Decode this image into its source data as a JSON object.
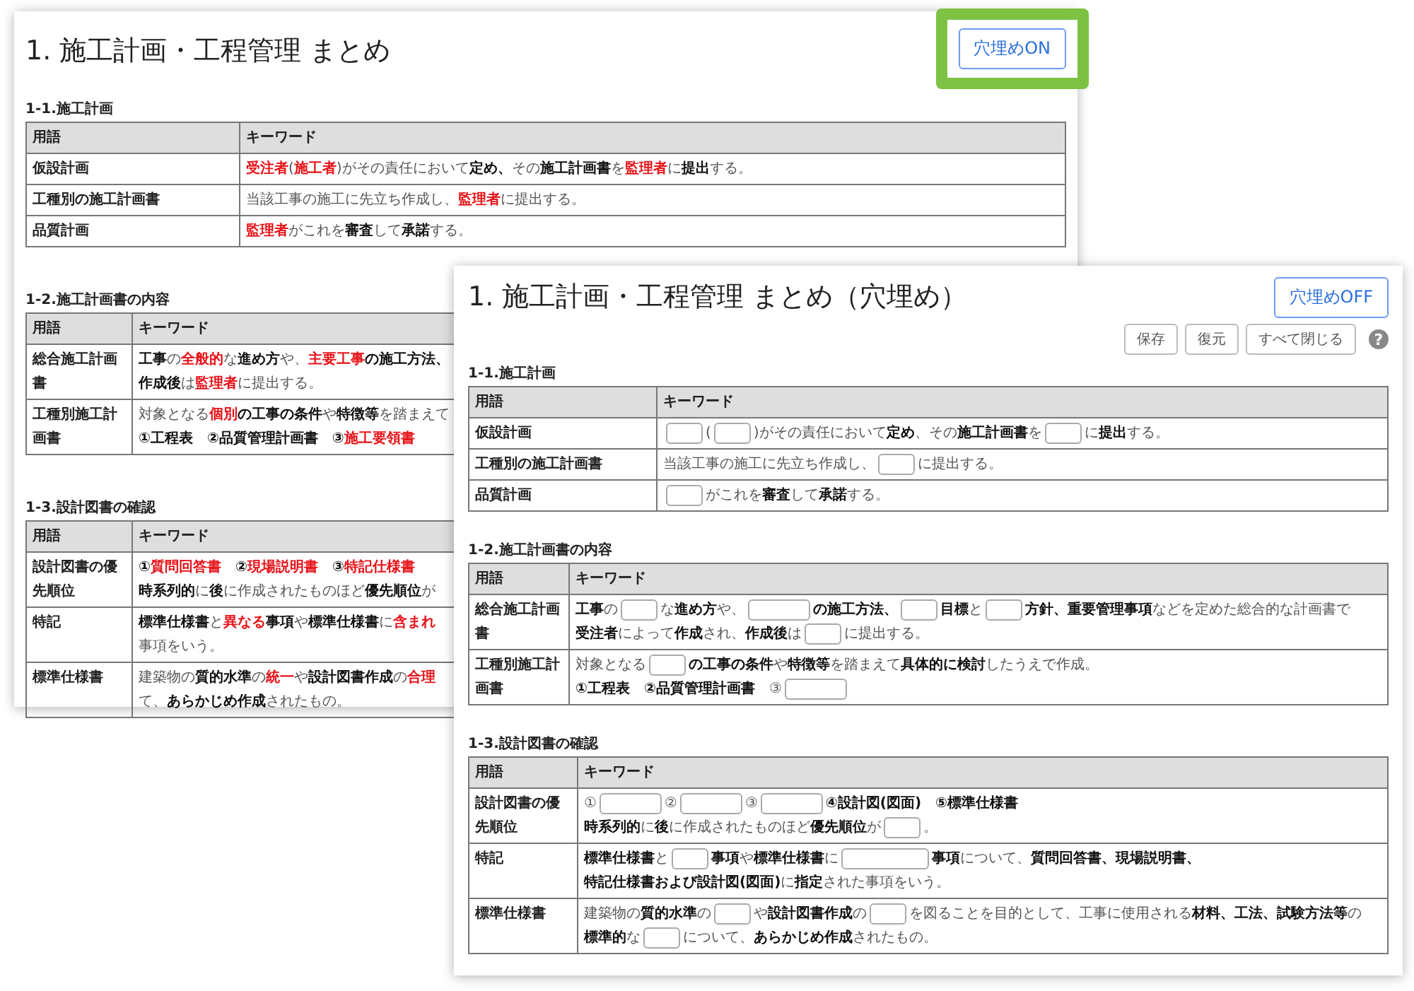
{
  "back_window": {
    "title": "1. 施工計画・工程管理 まとめ",
    "toggle_button": "穴埋めON",
    "sections": [
      {
        "heading": "1-1.施工計画",
        "columns": [
          "用語",
          "キーワード"
        ],
        "rows": [
          {
            "term": "仮設計画",
            "keyword": [
              {
                "kind": "red",
                "text": "受注者"
              },
              {
                "kind": "text",
                "text": "("
              },
              {
                "kind": "red",
                "text": "施工者"
              },
              {
                "kind": "text",
                "text": ")がその責任において"
              },
              {
                "kind": "bold",
                "text": "定め、"
              },
              {
                "kind": "text",
                "text": "その"
              },
              {
                "kind": "bold",
                "text": "施工計画書"
              },
              {
                "kind": "text",
                "text": "を"
              },
              {
                "kind": "red",
                "text": "監理者"
              },
              {
                "kind": "text",
                "text": "に"
              },
              {
                "kind": "bold",
                "text": "提出"
              },
              {
                "kind": "text",
                "text": "する。"
              }
            ]
          },
          {
            "term": "工種別の施工計画書",
            "keyword": [
              {
                "kind": "text",
                "text": "当該工事の施工に先立ち作成し、"
              },
              {
                "kind": "red",
                "text": "監理者"
              },
              {
                "kind": "text",
                "text": "に提出する。"
              }
            ]
          },
          {
            "term": "品質計画",
            "keyword": [
              {
                "kind": "red",
                "text": "監理者"
              },
              {
                "kind": "text",
                "text": "がこれを"
              },
              {
                "kind": "bold",
                "text": "審査"
              },
              {
                "kind": "text",
                "text": "して"
              },
              {
                "kind": "bold",
                "text": "承諾"
              },
              {
                "kind": "text",
                "text": "する。"
              }
            ]
          }
        ]
      },
      {
        "heading": "1-2.施工計画書の内容",
        "columns": [
          "用語",
          "キーワード"
        ],
        "rows": [
          {
            "term": "総合施工計画書",
            "keyword": [
              {
                "kind": "bold",
                "text": "工事"
              },
              {
                "kind": "text",
                "text": "の"
              },
              {
                "kind": "red",
                "text": "全般的"
              },
              {
                "kind": "text",
                "text": "な"
              },
              {
                "kind": "bold",
                "text": "進め方"
              },
              {
                "kind": "text",
                "text": "や、"
              },
              {
                "kind": "red",
                "text": "主要工事"
              },
              {
                "kind": "bold",
                "text": "の施工方法、"
              },
              {
                "kind": "break"
              },
              {
                "kind": "bold",
                "text": "作成後"
              },
              {
                "kind": "text",
                "text": "は"
              },
              {
                "kind": "red",
                "text": "監理者"
              },
              {
                "kind": "text",
                "text": "に提出する。"
              }
            ]
          },
          {
            "term": "工種別施工計画書",
            "keyword": [
              {
                "kind": "text",
                "text": "対象となる"
              },
              {
                "kind": "red",
                "text": "個別"
              },
              {
                "kind": "bold",
                "text": "の工事の条件"
              },
              {
                "kind": "text",
                "text": "や"
              },
              {
                "kind": "bold",
                "text": "特徴等"
              },
              {
                "kind": "text",
                "text": "を踏まえて"
              },
              {
                "kind": "break"
              },
              {
                "kind": "bold",
                "text": "①工程表　②品質管理計画書　③"
              },
              {
                "kind": "red",
                "text": "施工要領書"
              }
            ]
          }
        ]
      },
      {
        "heading": "1-3.設計図書の確認",
        "columns": [
          "用語",
          "キーワード"
        ],
        "rows": [
          {
            "term": "設計図書の優先順位",
            "keyword": [
              {
                "kind": "bold",
                "text": "①"
              },
              {
                "kind": "red",
                "text": "質問回答書"
              },
              {
                "kind": "bold",
                "text": "　②"
              },
              {
                "kind": "red",
                "text": "現場説明書"
              },
              {
                "kind": "bold",
                "text": "　③"
              },
              {
                "kind": "red",
                "text": "特記仕様書"
              },
              {
                "kind": "break"
              },
              {
                "kind": "bold",
                "text": "時系列的"
              },
              {
                "kind": "text",
                "text": "に"
              },
              {
                "kind": "bold",
                "text": "後"
              },
              {
                "kind": "text",
                "text": "に作成されたものほど"
              },
              {
                "kind": "bold",
                "text": "優先順位"
              },
              {
                "kind": "text",
                "text": "が"
              }
            ]
          },
          {
            "term": "特記",
            "keyword": [
              {
                "kind": "bold",
                "text": "標準仕様書"
              },
              {
                "kind": "text",
                "text": "と"
              },
              {
                "kind": "red",
                "text": "異なる"
              },
              {
                "kind": "bold",
                "text": "事項"
              },
              {
                "kind": "text",
                "text": "や"
              },
              {
                "kind": "bold",
                "text": "標準仕様書"
              },
              {
                "kind": "text",
                "text": "に"
              },
              {
                "kind": "red",
                "text": "含まれ"
              },
              {
                "kind": "break"
              },
              {
                "kind": "text",
                "text": "事項をいう。"
              }
            ]
          },
          {
            "term": "標準仕様書",
            "keyword": [
              {
                "kind": "text",
                "text": "建築物の"
              },
              {
                "kind": "bold",
                "text": "質的水準"
              },
              {
                "kind": "text",
                "text": "の"
              },
              {
                "kind": "red",
                "text": "統一"
              },
              {
                "kind": "text",
                "text": "や"
              },
              {
                "kind": "bold",
                "text": "設計図書作成"
              },
              {
                "kind": "text",
                "text": "の"
              },
              {
                "kind": "red",
                "text": "合理"
              },
              {
                "kind": "break"
              },
              {
                "kind": "text",
                "text": "て、"
              },
              {
                "kind": "bold",
                "text": "あらかじめ作成"
              },
              {
                "kind": "text",
                "text": "されたもの。"
              }
            ]
          }
        ]
      }
    ]
  },
  "front_window": {
    "title": "1. 施工計画・工程管理 まとめ（穴埋め）",
    "toggle_button": "穴埋めOFF",
    "toolbar": [
      "保存",
      "復元",
      "すべて閉じる"
    ],
    "help": "?",
    "sections": [
      {
        "heading": "1-1.施工計画",
        "columns": [
          "用語",
          "キーワード"
        ],
        "rows": [
          {
            "term": "仮設計画",
            "keyword": [
              {
                "kind": "blank"
              },
              {
                "kind": "text",
                "text": "("
              },
              {
                "kind": "blank"
              },
              {
                "kind": "text",
                "text": ")がその責任において"
              },
              {
                "kind": "bold",
                "text": "定め"
              },
              {
                "kind": "text",
                "text": "、その"
              },
              {
                "kind": "bold",
                "text": "施工計画書"
              },
              {
                "kind": "text",
                "text": "を"
              },
              {
                "kind": "blank"
              },
              {
                "kind": "text",
                "text": "に"
              },
              {
                "kind": "bold",
                "text": "提出"
              },
              {
                "kind": "text",
                "text": "する。"
              }
            ]
          },
          {
            "term": "工種別の施工計画書",
            "keyword": [
              {
                "kind": "text",
                "text": "当該工事の施工に先立ち作成し、"
              },
              {
                "kind": "blank"
              },
              {
                "kind": "text",
                "text": "に提出する。"
              }
            ]
          },
          {
            "term": "品質計画",
            "keyword": [
              {
                "kind": "blank"
              },
              {
                "kind": "text",
                "text": "がこれを"
              },
              {
                "kind": "bold",
                "text": "審査"
              },
              {
                "kind": "text",
                "text": "して"
              },
              {
                "kind": "bold",
                "text": "承諾"
              },
              {
                "kind": "text",
                "text": "する。"
              }
            ]
          }
        ]
      },
      {
        "heading": "1-2.施工計画書の内容",
        "columns": [
          "用語",
          "キーワード"
        ],
        "rows": [
          {
            "term": "総合施工計画書",
            "keyword": [
              {
                "kind": "bold",
                "text": "工事"
              },
              {
                "kind": "text",
                "text": "の"
              },
              {
                "kind": "blank"
              },
              {
                "kind": "text",
                "text": "な"
              },
              {
                "kind": "bold",
                "text": "進め方"
              },
              {
                "kind": "text",
                "text": "や、"
              },
              {
                "kind": "wide_blank"
              },
              {
                "kind": "bold",
                "text": "の施工方法、"
              },
              {
                "kind": "blank"
              },
              {
                "kind": "bold",
                "text": "目標"
              },
              {
                "kind": "text",
                "text": "と"
              },
              {
                "kind": "blank"
              },
              {
                "kind": "bold",
                "text": "方針、重要管理事項"
              },
              {
                "kind": "text",
                "text": "などを定めた総合的な計画書で"
              },
              {
                "kind": "bold",
                "text": "受注者"
              },
              {
                "kind": "text",
                "text": "によって"
              },
              {
                "kind": "bold",
                "text": "作成"
              },
              {
                "kind": "text",
                "text": "され、"
              },
              {
                "kind": "bold",
                "text": "作成後"
              },
              {
                "kind": "text",
                "text": "は"
              },
              {
                "kind": "blank"
              },
              {
                "kind": "text",
                "text": "に提出する。"
              }
            ]
          },
          {
            "term": "工種別施工計画書",
            "keyword": [
              {
                "kind": "text",
                "text": "対象となる"
              },
              {
                "kind": "blank"
              },
              {
                "kind": "bold",
                "text": "の工事の条件"
              },
              {
                "kind": "text",
                "text": "や"
              },
              {
                "kind": "bold",
                "text": "特徴等"
              },
              {
                "kind": "text",
                "text": "を踏まえて"
              },
              {
                "kind": "bold",
                "text": "具体的に検討"
              },
              {
                "kind": "text",
                "text": "したうえで作成。"
              },
              {
                "kind": "break"
              },
              {
                "kind": "bold",
                "text": "①工程表　②品質管理計画書　"
              },
              {
                "kind": "text",
                "text": "③"
              },
              {
                "kind": "wide_blank"
              }
            ]
          }
        ]
      },
      {
        "heading": "1-3.設計図書の確認",
        "columns": [
          "用語",
          "キーワード"
        ],
        "rows": [
          {
            "term": "設計図書の優先順位",
            "keyword": [
              {
                "kind": "text",
                "text": "①"
              },
              {
                "kind": "wide_blank"
              },
              {
                "kind": "text",
                "text": "②"
              },
              {
                "kind": "wide_blank"
              },
              {
                "kind": "text",
                "text": "③"
              },
              {
                "kind": "wide_blank"
              },
              {
                "kind": "bold",
                "text": "④設計図(図面)　⑤標準仕様書"
              },
              {
                "kind": "break"
              },
              {
                "kind": "bold",
                "text": "時系列的"
              },
              {
                "kind": "text",
                "text": "に"
              },
              {
                "kind": "bold",
                "text": "後"
              },
              {
                "kind": "text",
                "text": "に作成されたものほど"
              },
              {
                "kind": "bold",
                "text": "優先順位"
              },
              {
                "kind": "text",
                "text": "が"
              },
              {
                "kind": "blank"
              },
              {
                "kind": "text",
                "text": "。"
              }
            ]
          },
          {
            "term": "特記",
            "keyword": [
              {
                "kind": "bold",
                "text": "標準仕様書"
              },
              {
                "kind": "text",
                "text": "と"
              },
              {
                "kind": "blank"
              },
              {
                "kind": "bold",
                "text": "事項"
              },
              {
                "kind": "text",
                "text": "や"
              },
              {
                "kind": "bold",
                "text": "標準仕様書"
              },
              {
                "kind": "text",
                "text": "に"
              },
              {
                "kind": "long_blank"
              },
              {
                "kind": "bold",
                "text": "事項"
              },
              {
                "kind": "text",
                "text": "について、"
              },
              {
                "kind": "bold",
                "text": "質問回答書、現場説明書、"
              },
              {
                "kind": "bold",
                "text": "特記仕様書および設計図(図面)"
              },
              {
                "kind": "text",
                "text": "に"
              },
              {
                "kind": "bold",
                "text": "指定"
              },
              {
                "kind": "text",
                "text": "された事項をいう。"
              }
            ]
          },
          {
            "term": "標準仕様書",
            "keyword": [
              {
                "kind": "text",
                "text": "建築物の"
              },
              {
                "kind": "bold",
                "text": "質的水準"
              },
              {
                "kind": "text",
                "text": "の"
              },
              {
                "kind": "blank"
              },
              {
                "kind": "text",
                "text": "や"
              },
              {
                "kind": "bold",
                "text": "設計図書作成"
              },
              {
                "kind": "text",
                "text": "の"
              },
              {
                "kind": "blank"
              },
              {
                "kind": "text",
                "text": "を図ることを目的として、工事に使用される"
              },
              {
                "kind": "bold",
                "text": "材料、工法、試験方法等"
              },
              {
                "kind": "text",
                "text": "の"
              },
              {
                "kind": "bold",
                "text": "標準的"
              },
              {
                "kind": "text",
                "text": "な"
              },
              {
                "kind": "blank"
              },
              {
                "kind": "text",
                "text": "について、"
              },
              {
                "kind": "bold",
                "text": "あらかじめ作成"
              },
              {
                "kind": "text",
                "text": "されたもの。"
              }
            ]
          }
        ]
      }
    ]
  }
}
